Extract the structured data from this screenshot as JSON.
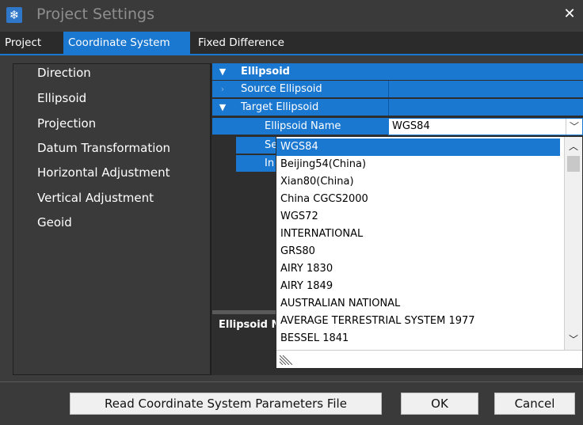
{
  "window": {
    "title": "Project Settings",
    "close_glyph": "✕",
    "icon": "snowflake-icon"
  },
  "tabs": [
    {
      "label": "Project"
    },
    {
      "label": "Coordinate System"
    },
    {
      "label": "Fixed Difference"
    }
  ],
  "nav": {
    "items": [
      {
        "label": "Direction"
      },
      {
        "label": "Ellipsoid"
      },
      {
        "label": "Projection"
      },
      {
        "label": "Datum Transformation"
      },
      {
        "label": "Horizontal Adjustment"
      },
      {
        "label": "Vertical Adjustment"
      },
      {
        "label": "Geoid"
      }
    ]
  },
  "grid": {
    "section": "Ellipsoid",
    "source": "Source Ellipsoid",
    "target": "Target Ellipsoid",
    "name_label": "Ellipsoid Name",
    "partial_row1": "Se",
    "partial_row2": "In",
    "name_value": "WGS84"
  },
  "description": {
    "title_partial": "Ellipsoid N"
  },
  "dropdown": {
    "options": [
      "WGS84",
      "Beijing54(China)",
      "Xian80(China)",
      "China CGCS2000",
      "WGS72",
      "INTERNATIONAL",
      "GRS80",
      "AIRY 1830",
      "AIRY 1849",
      "AUSTRALIAN NATIONAL",
      "AVERAGE TERRESTRIAL SYSTEM 1977",
      "BESSEL 1841"
    ],
    "selected": "WGS84"
  },
  "buttons": {
    "read_params": "Read Coordinate System Parameters File",
    "ok": "OK",
    "cancel": "Cancel"
  },
  "colors": {
    "accent": "#1b78d0",
    "background": "#3c3c3c"
  }
}
